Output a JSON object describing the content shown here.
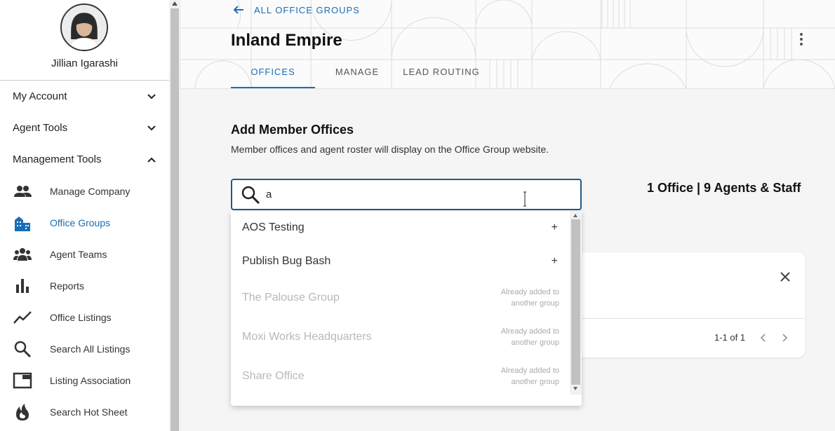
{
  "profile": {
    "name": "Jillian Igarashi"
  },
  "sidebar": {
    "sections": [
      {
        "label": "My Account",
        "expanded": false
      },
      {
        "label": "Agent Tools",
        "expanded": false
      },
      {
        "label": "Management Tools",
        "expanded": true
      }
    ],
    "items": [
      {
        "label": "Manage Company",
        "icon": "people-icon"
      },
      {
        "label": "Office Groups",
        "icon": "buildings-icon",
        "active": true
      },
      {
        "label": "Agent Teams",
        "icon": "team-icon"
      },
      {
        "label": "Reports",
        "icon": "bar-chart-icon"
      },
      {
        "label": "Office Listings",
        "icon": "trend-line-icon"
      },
      {
        "label": "Search All Listings",
        "icon": "search-icon"
      },
      {
        "label": "Listing Association",
        "icon": "window-icon"
      },
      {
        "label": "Search Hot Sheet",
        "icon": "flame-icon"
      }
    ]
  },
  "header": {
    "back_label": "ALL OFFICE GROUPS",
    "title": "Inland Empire",
    "tabs": [
      {
        "label": "OFFICES",
        "active": true
      },
      {
        "label": "MANAGE",
        "active": false
      },
      {
        "label": "LEAD ROUTING",
        "active": false
      }
    ]
  },
  "main": {
    "section_title": "Add Member Offices",
    "section_desc": "Member offices and agent roster will display on the Office Group website.",
    "search_value": "a",
    "summary": "1 Office | 9 Agents & Staff",
    "pagination": "1-1 of 1"
  },
  "dropdown": {
    "items": [
      {
        "label": "AOS Testing",
        "action": "+",
        "disabled": false
      },
      {
        "label": "Publish Bug Bash",
        "action": "+",
        "disabled": false
      },
      {
        "label": "The Palouse Group",
        "note_line1": "Already added to",
        "note_line2": "another group",
        "disabled": true
      },
      {
        "label": "Moxi Works Headquarters",
        "note_line1": "Already added to",
        "note_line2": "another group",
        "disabled": true
      },
      {
        "label": "Share Office",
        "note_line1": "Already added to",
        "note_line2": "another group",
        "disabled": true
      }
    ]
  },
  "colors": {
    "accent": "#1a6db5",
    "search_border": "#1f5a85"
  }
}
